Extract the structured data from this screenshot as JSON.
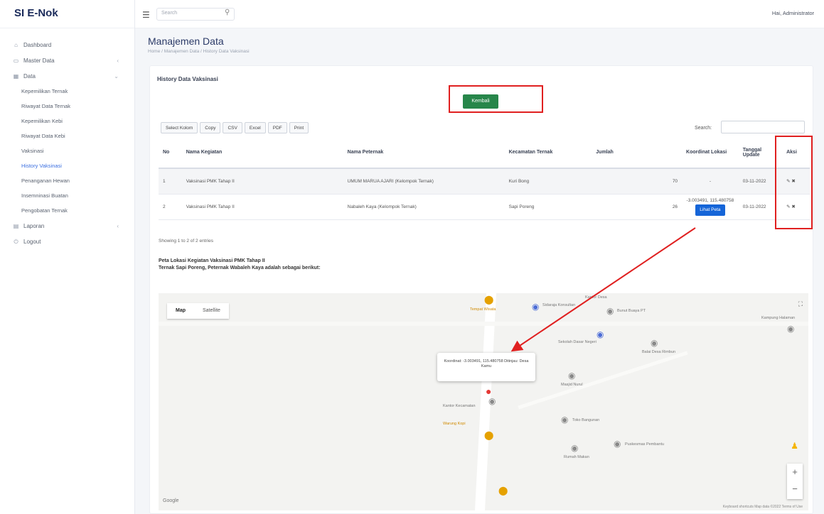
{
  "app": {
    "brand": "SI E-Nok"
  },
  "sidebar": {
    "items": [
      {
        "label": "Dashboard",
        "icon": "home-icon"
      },
      {
        "label": "Master Data",
        "icon": "folder-icon"
      },
      {
        "label": "Data",
        "icon": "grid-icon"
      }
    ],
    "subitems": [
      "Kepemilikan Ternak",
      "Riwayat Data Ternak",
      "Kepemilikan Kebi",
      "Riwayat Data Kebi",
      "Vaksinasi",
      "History Vaksinasi",
      "Penanganan Hewan",
      "Insemninasi Buatan",
      "Pengobatan Ternak"
    ],
    "bottom": [
      {
        "label": "Laporan",
        "icon": "file-icon"
      },
      {
        "label": "Logout",
        "icon": "logout-icon"
      }
    ]
  },
  "topbar": {
    "search_placeholder": "Search",
    "user": "Hai, Administrator"
  },
  "page": {
    "title": "Manajemen Data",
    "breadcrumb": "Home / Manajemen Data / History Data Vaksinasi"
  },
  "card": {
    "title": "History Data Vaksinasi",
    "kembali_label": "Kembali",
    "export_buttons": [
      "Select Kolom",
      "Copy",
      "CSV",
      "Excel",
      "PDF",
      "Print"
    ],
    "search_label": "Search:",
    "columns": [
      "No",
      "Nama Kegiatan",
      "Nama Peternak",
      "Kecamatan Ternak",
      "Jumlah",
      "Koordinat Lokasi",
      "Tanggal Update",
      "Aksi"
    ],
    "rows": [
      {
        "no": "1",
        "kegiatan": "Vaksinasi PMK Tahap II",
        "peternak": "UMUM MARUA AJARI (Kelompok Ternak)",
        "kecamatan": "Kuri Bong",
        "jumlah": "70",
        "koordinat": "-",
        "tanggal": "03-11-2022",
        "aksi": "✎ ✖"
      },
      {
        "no": "2",
        "kegiatan": "Vaksinasi PMK Tahap II",
        "peternak": "Nabaleh Kaya (Kelompok Ternak)",
        "kecamatan": "Sapi Poreng",
        "jumlah": "26",
        "koordinat": "-3.003491, 115.480758",
        "lihat": "Lihat Peta",
        "tanggal": "03-11-2022",
        "aksi": "✎ ✖"
      }
    ],
    "showing": "Showing 1 to 2 of 2 entries",
    "map_caption_1": "Peta Lokasi Kegiatan Vaksinasi PMK Tahap II",
    "map_caption_2": "Ternak Sapi Poreng, Peternak Wabaleh Kaya adalah sebagai berikut:"
  },
  "map": {
    "tab_map": "Map",
    "tab_satellite": "Satellite",
    "info": "Koordinat: -3.003491, 115.480758  Ditinjau: Desa Kamu",
    "google": "Google",
    "attribution": "Keyboard shortcuts  Map data ©2022  Terms of Use",
    "zoom_in": "+",
    "zoom_out": "−",
    "pins": [
      {
        "label": "Tempat Wisata"
      },
      {
        "label": "Sidaraja Konsultan"
      },
      {
        "label": "Kantor Desa"
      },
      {
        "label": "Bunut Buaya PT"
      },
      {
        "label": "Sekolah Dasar Negeri"
      },
      {
        "label": "Balai Desa Rimbun"
      },
      {
        "label": "Masjid Nurul"
      },
      {
        "label": "Kantor Kecamatan"
      },
      {
        "label": "Warung Kopi"
      },
      {
        "label": "Toko Bangunan"
      },
      {
        "label": "Rumah Makan"
      },
      {
        "label": "Puskesmas Pembantu"
      },
      {
        "label": "Kampung Halaman"
      }
    ]
  }
}
